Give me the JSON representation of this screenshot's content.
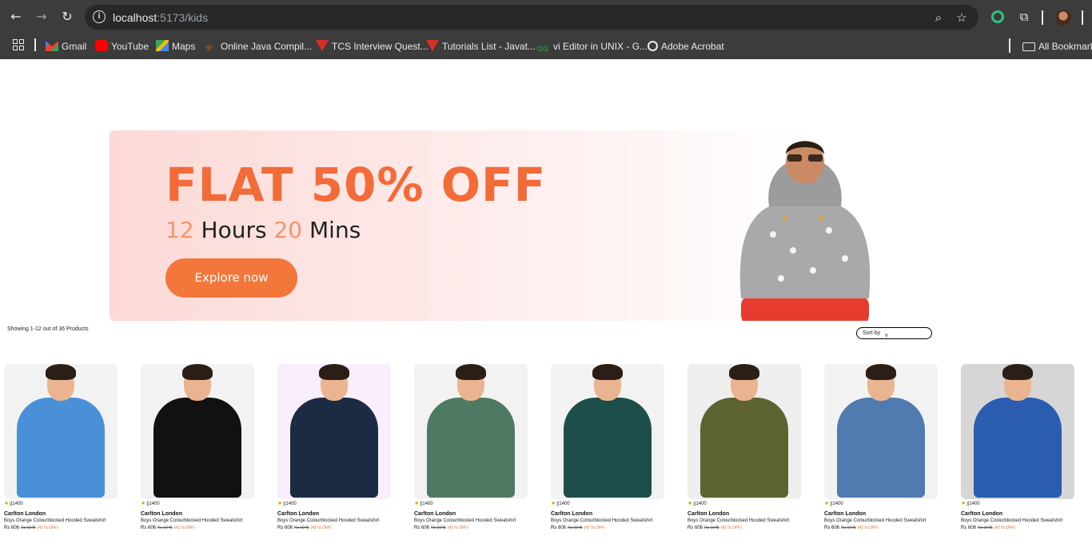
{
  "browser": {
    "url_host": "localhost",
    "url_path": ":5173/kids",
    "bookmarks": [
      {
        "label": "Gmail",
        "icon": "gmail-icon",
        "color": "#ea4335"
      },
      {
        "label": "YouTube",
        "icon": "youtube-icon",
        "color": "#ff0000"
      },
      {
        "label": "Maps",
        "icon": "maps-icon",
        "color": "#34a853"
      },
      {
        "label": "Online Java Compil...",
        "icon": "java-icon",
        "color": "#e8710a"
      },
      {
        "label": "TCS Interview Quest...",
        "icon": "javatpoint-icon",
        "color": "#d93025"
      },
      {
        "label": "Tutorials List - Javat...",
        "icon": "javatpoint-icon",
        "color": "#d93025"
      },
      {
        "label": "vi Editor in UNIX - G...",
        "icon": "geeksforgeeks-icon",
        "color": "#2f8d46"
      },
      {
        "label": "Adobe Acrobat",
        "icon": "globe-icon",
        "color": "#e8eaed"
      }
    ],
    "all_bookmarks": "All Bookmarks"
  },
  "banner": {
    "title": "FLAT 50% OFF",
    "hours": "12",
    "hours_label": " Hours ",
    "mins": "20",
    "mins_label": " Mins",
    "cta": "Explore now",
    "accent": "#f26b38"
  },
  "listing": {
    "showing": "Showing 1-12 out of 36 Products",
    "sort_label": "Sort by"
  },
  "products": [
    {
      "rating": "||1400",
      "brand": "Carlton London",
      "name": "Boys Orange Colourblocked Hooded Sweatshirt",
      "price": "Rs 606",
      "old": "Rs 1045",
      "off": "(42 % OFF)",
      "bg": "#f2f2f2",
      "outfit": "#4a90d9"
    },
    {
      "rating": "||1400",
      "brand": "Carlton London",
      "name": "Boys Orange Colourblocked Hooded Sweatshirt",
      "price": "Rs 606",
      "old": "Rs 1045",
      "off": "(42 % OFF)",
      "bg": "#f2f2f2",
      "outfit": "#111111"
    },
    {
      "rating": "||1400",
      "brand": "Carlton London",
      "name": "Boys Orange Colourblocked Hooded Sweatshirt",
      "price": "Rs 606",
      "old": "Rs 1045",
      "off": "(42 % OFF)",
      "bg": "#f9eefb",
      "outfit": "#1d2a44"
    },
    {
      "rating": "||1400",
      "brand": "Carlton London",
      "name": "Boys Orange Colourblocked Hooded Sweatshirt",
      "price": "Rs 606",
      "old": "Rs 1045",
      "off": "(42 % OFF)",
      "bg": "#f2f2f2",
      "outfit": "#4e7a63"
    },
    {
      "rating": "||1400",
      "brand": "Carlton London",
      "name": "Boys Orange Colourblocked Hooded Sweatshirt",
      "price": "Rs 606",
      "old": "Rs 1045",
      "off": "(42 % OFF)",
      "bg": "#f2f2f2",
      "outfit": "#1e4e4a"
    },
    {
      "rating": "||1400",
      "brand": "Carlton London",
      "name": "Boys Orange Colourblocked Hooded Sweatshirt",
      "price": "Rs 606",
      "old": "Rs 1045",
      "off": "(42 % OFF)",
      "bg": "#eeeeee",
      "outfit": "#5c6230"
    },
    {
      "rating": "||1400",
      "brand": "Carlton London",
      "name": "Boys Orange Colourblocked Hooded Sweatshirt",
      "price": "Rs 606",
      "old": "Rs 1045",
      "off": "(42 % OFF)",
      "bg": "#f2f2f2",
      "outfit": "#4f7bb0"
    },
    {
      "rating": "||1400",
      "brand": "Carlton London",
      "name": "Boys Orange Colourblocked Hooded Sweatshirt",
      "price": "Rs 606",
      "old": "Rs 1045",
      "off": "(42 % OFF)",
      "bg": "#d6d6d6",
      "outfit": "#2a5db0"
    }
  ]
}
